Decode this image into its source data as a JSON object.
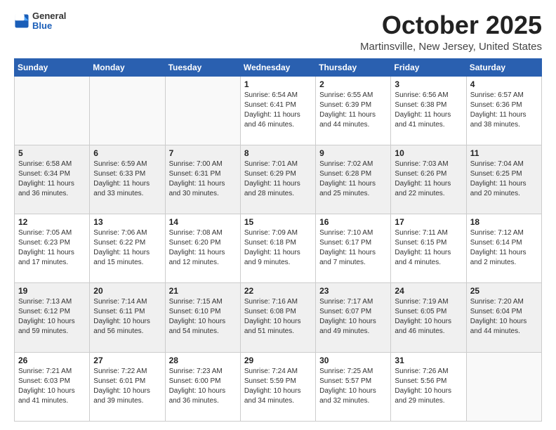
{
  "header": {
    "logo_general": "General",
    "logo_blue": "Blue",
    "month_title": "October 2025",
    "location": "Martinsville, New Jersey, United States"
  },
  "weekdays": [
    "Sunday",
    "Monday",
    "Tuesday",
    "Wednesday",
    "Thursday",
    "Friday",
    "Saturday"
  ],
  "weeks": [
    [
      {
        "day": "",
        "info": ""
      },
      {
        "day": "",
        "info": ""
      },
      {
        "day": "",
        "info": ""
      },
      {
        "day": "1",
        "info": "Sunrise: 6:54 AM\nSunset: 6:41 PM\nDaylight: 11 hours\nand 46 minutes."
      },
      {
        "day": "2",
        "info": "Sunrise: 6:55 AM\nSunset: 6:39 PM\nDaylight: 11 hours\nand 44 minutes."
      },
      {
        "day": "3",
        "info": "Sunrise: 6:56 AM\nSunset: 6:38 PM\nDaylight: 11 hours\nand 41 minutes."
      },
      {
        "day": "4",
        "info": "Sunrise: 6:57 AM\nSunset: 6:36 PM\nDaylight: 11 hours\nand 38 minutes."
      }
    ],
    [
      {
        "day": "5",
        "info": "Sunrise: 6:58 AM\nSunset: 6:34 PM\nDaylight: 11 hours\nand 36 minutes."
      },
      {
        "day": "6",
        "info": "Sunrise: 6:59 AM\nSunset: 6:33 PM\nDaylight: 11 hours\nand 33 minutes."
      },
      {
        "day": "7",
        "info": "Sunrise: 7:00 AM\nSunset: 6:31 PM\nDaylight: 11 hours\nand 30 minutes."
      },
      {
        "day": "8",
        "info": "Sunrise: 7:01 AM\nSunset: 6:29 PM\nDaylight: 11 hours\nand 28 minutes."
      },
      {
        "day": "9",
        "info": "Sunrise: 7:02 AM\nSunset: 6:28 PM\nDaylight: 11 hours\nand 25 minutes."
      },
      {
        "day": "10",
        "info": "Sunrise: 7:03 AM\nSunset: 6:26 PM\nDaylight: 11 hours\nand 22 minutes."
      },
      {
        "day": "11",
        "info": "Sunrise: 7:04 AM\nSunset: 6:25 PM\nDaylight: 11 hours\nand 20 minutes."
      }
    ],
    [
      {
        "day": "12",
        "info": "Sunrise: 7:05 AM\nSunset: 6:23 PM\nDaylight: 11 hours\nand 17 minutes."
      },
      {
        "day": "13",
        "info": "Sunrise: 7:06 AM\nSunset: 6:22 PM\nDaylight: 11 hours\nand 15 minutes."
      },
      {
        "day": "14",
        "info": "Sunrise: 7:08 AM\nSunset: 6:20 PM\nDaylight: 11 hours\nand 12 minutes."
      },
      {
        "day": "15",
        "info": "Sunrise: 7:09 AM\nSunset: 6:18 PM\nDaylight: 11 hours\nand 9 minutes."
      },
      {
        "day": "16",
        "info": "Sunrise: 7:10 AM\nSunset: 6:17 PM\nDaylight: 11 hours\nand 7 minutes."
      },
      {
        "day": "17",
        "info": "Sunrise: 7:11 AM\nSunset: 6:15 PM\nDaylight: 11 hours\nand 4 minutes."
      },
      {
        "day": "18",
        "info": "Sunrise: 7:12 AM\nSunset: 6:14 PM\nDaylight: 11 hours\nand 2 minutes."
      }
    ],
    [
      {
        "day": "19",
        "info": "Sunrise: 7:13 AM\nSunset: 6:12 PM\nDaylight: 10 hours\nand 59 minutes."
      },
      {
        "day": "20",
        "info": "Sunrise: 7:14 AM\nSunset: 6:11 PM\nDaylight: 10 hours\nand 56 minutes."
      },
      {
        "day": "21",
        "info": "Sunrise: 7:15 AM\nSunset: 6:10 PM\nDaylight: 10 hours\nand 54 minutes."
      },
      {
        "day": "22",
        "info": "Sunrise: 7:16 AM\nSunset: 6:08 PM\nDaylight: 10 hours\nand 51 minutes."
      },
      {
        "day": "23",
        "info": "Sunrise: 7:17 AM\nSunset: 6:07 PM\nDaylight: 10 hours\nand 49 minutes."
      },
      {
        "day": "24",
        "info": "Sunrise: 7:19 AM\nSunset: 6:05 PM\nDaylight: 10 hours\nand 46 minutes."
      },
      {
        "day": "25",
        "info": "Sunrise: 7:20 AM\nSunset: 6:04 PM\nDaylight: 10 hours\nand 44 minutes."
      }
    ],
    [
      {
        "day": "26",
        "info": "Sunrise: 7:21 AM\nSunset: 6:03 PM\nDaylight: 10 hours\nand 41 minutes."
      },
      {
        "day": "27",
        "info": "Sunrise: 7:22 AM\nSunset: 6:01 PM\nDaylight: 10 hours\nand 39 minutes."
      },
      {
        "day": "28",
        "info": "Sunrise: 7:23 AM\nSunset: 6:00 PM\nDaylight: 10 hours\nand 36 minutes."
      },
      {
        "day": "29",
        "info": "Sunrise: 7:24 AM\nSunset: 5:59 PM\nDaylight: 10 hours\nand 34 minutes."
      },
      {
        "day": "30",
        "info": "Sunrise: 7:25 AM\nSunset: 5:57 PM\nDaylight: 10 hours\nand 32 minutes."
      },
      {
        "day": "31",
        "info": "Sunrise: 7:26 AM\nSunset: 5:56 PM\nDaylight: 10 hours\nand 29 minutes."
      },
      {
        "day": "",
        "info": ""
      }
    ]
  ],
  "shaded_rows": [
    1,
    3
  ]
}
